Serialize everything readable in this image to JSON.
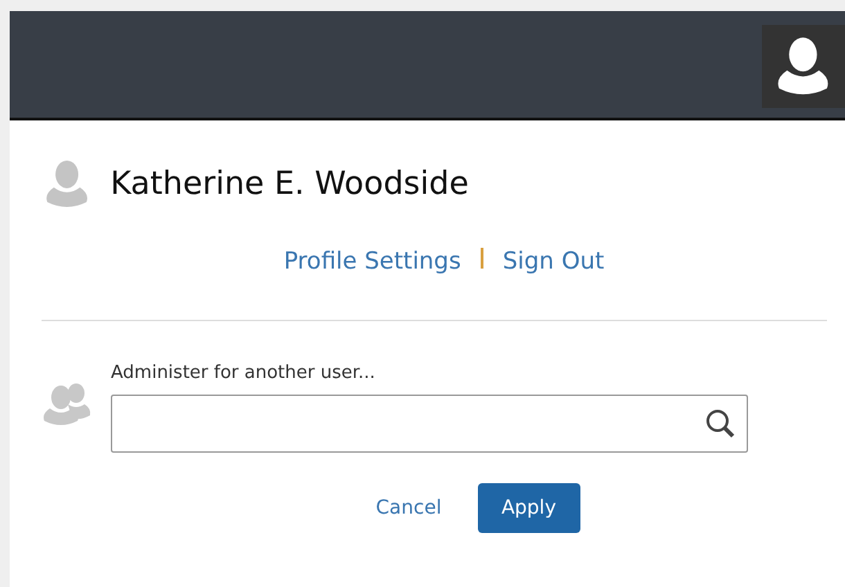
{
  "user": {
    "name": "Katherine E. Woodside"
  },
  "links": [
    {
      "label": "Profile Settings"
    },
    {
      "label": "Sign Out"
    }
  ],
  "administer": {
    "label": "Administer for another user..."
  },
  "buttons": [
    {
      "label": "Cancel",
      "kind": "link"
    },
    {
      "label": "Apply",
      "kind": "primary"
    }
  ]
}
